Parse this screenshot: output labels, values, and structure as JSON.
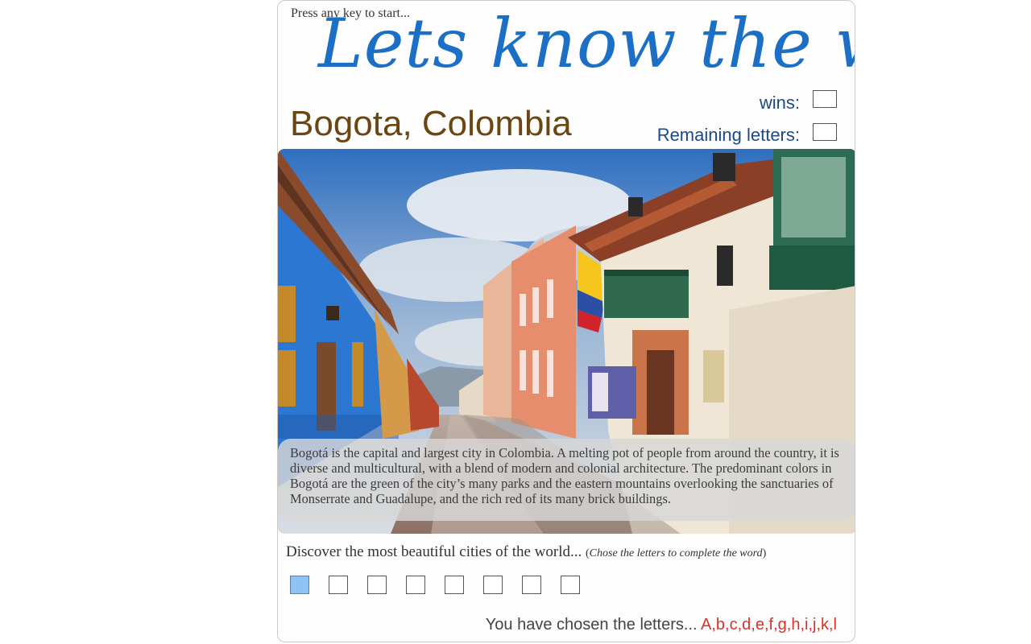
{
  "header": {
    "press_key": "Press any key to start...",
    "title": "Lets know the world",
    "city": "Bogota, Colombia"
  },
  "stats": {
    "wins_label": "wins:",
    "wins_value": "",
    "remaining_label": "Remaining letters:",
    "remaining_value": ""
  },
  "description": "Bogotá is the capital and largest city in Colombia. A melting pot of people from around the country, it is diverse and multicultural, with a blend of modern and colonial architecture. The predominant colors in Bogotá are the green of the city’s many parks and the eastern mountains overlooking the sanctuaries of Monserrate and Guadalupe, and the rich red of its many brick buildings.",
  "prompt": {
    "text": "Discover the most beautiful cities of the world...",
    "hint_open": "(",
    "hint": "Chose the letters to complete the word",
    "hint_close": ")"
  },
  "word_slots": [
    "",
    "",
    "",
    "",
    "",
    "",
    "",
    ""
  ],
  "active_slot": 0,
  "chosen": {
    "label": "You have chosen the letters...",
    "letters": "A,b,c,d,e,f,g,h,i,j,k,l"
  },
  "colors": {
    "title": "#1b6fc4",
    "city": "#6b4613",
    "stats": "#1d4a82",
    "chosen_letters": "#d8322a",
    "active_slot": "#8ec1f4"
  }
}
